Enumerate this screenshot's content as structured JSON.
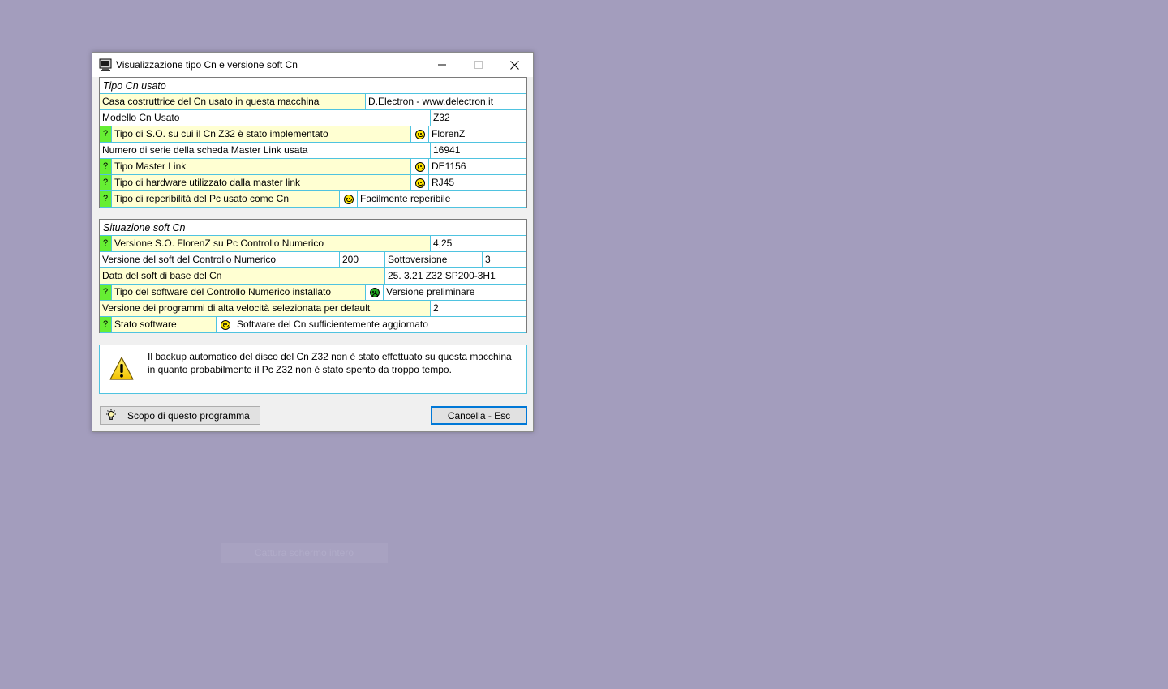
{
  "window": {
    "title": "Visualizzazione tipo Cn e versione soft Cn"
  },
  "section1": {
    "header": "Tipo Cn usato",
    "rows": {
      "manufacturer_label": "Casa costruttrice del Cn usato in questa macchina",
      "manufacturer_value": "D.Electron - www.delectron.it",
      "model_label": "Modello Cn Usato",
      "model_value": "Z32",
      "os_q": "?",
      "os_label": "Tipo di S.O. su cui il Cn Z32 è stato implementato",
      "os_value": "FlorenZ",
      "serial_label": "Numero di serie della scheda Master Link usata",
      "serial_value": "16941",
      "ml_q": "?",
      "ml_label": "Tipo Master Link",
      "ml_value": "DE1156",
      "hw_q": "?",
      "hw_label": "Tipo di hardware utilizzato dalla master link",
      "hw_value": "RJ45",
      "pc_q": "?",
      "pc_label": "Tipo di reperibilità del Pc usato come Cn",
      "pc_value": "Facilmente reperibile"
    }
  },
  "section2": {
    "header": "Situazione soft Cn",
    "rows": {
      "ver_q": "?",
      "ver_label": "Versione S.O. FlorenZ su Pc Controllo Numerico",
      "ver_value": "4,25",
      "soft_label": "Versione del soft del Controllo Numerico",
      "soft_value": "200",
      "sub_label": "Sottoversione",
      "sub_value": "3",
      "date_label": "Data del soft di base del Cn",
      "date_value": "25. 3.21 Z32 SP200-3H1",
      "type_q": "?",
      "type_label": "Tipo del software del Controllo Numerico installato",
      "type_value": "Versione preliminare",
      "hs_label": "Versione dei programmi di alta velocità selezionata per default",
      "hs_value": "2",
      "state_q": "?",
      "state_label": "Stato software",
      "state_value": "Software del Cn sufficientemente aggiornato"
    }
  },
  "warning": {
    "text": "Il backup automatico del disco del Cn Z32 non è stato effettuato su questa macchina in quanto probabilmente il Pc Z32 non è stato spento da troppo tempo."
  },
  "buttons": {
    "scope": "Scopo di questo programma",
    "cancel": "Cancella - Esc"
  },
  "background": {
    "ghost_label": "Cattura schermo intero"
  },
  "colors": {
    "desktop": "#a39dbd",
    "row_yellow": "#ffffd2",
    "grid_line": "#4fc3e0",
    "question_green": "#66ee33",
    "focus_blue": "#0078d7"
  }
}
